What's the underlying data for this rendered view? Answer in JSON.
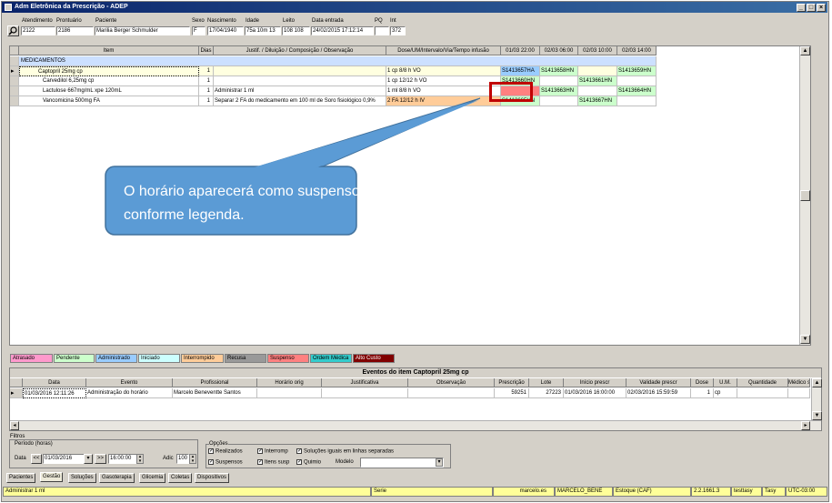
{
  "window": {
    "title": "Adm Eletrônica da Prescrição - ADEP",
    "min": "_",
    "max": "□",
    "close": "×"
  },
  "header": {
    "labels": {
      "atendimento": "Atendimento",
      "prontuario": "Prontuário",
      "paciente": "Paciente",
      "sexo": "Sexo",
      "nascimento": "Nascimento",
      "idade": "Idade",
      "leito": "Leito",
      "data_entrada": "Data entrada",
      "pq": "PQ",
      "int": "Int"
    },
    "values": {
      "atendimento": "2122",
      "prontuario": "2186",
      "paciente": "Marilia Berger Schmulder",
      "sexo": "F",
      "nascimento": "17/04/1940",
      "idade": "75a 10m 13",
      "leito": "108 108",
      "data_entrada": "24/02/2015 17:12:14",
      "pq": "",
      "int": "372"
    }
  },
  "grid": {
    "columns": [
      "Item",
      "Dias",
      "Justif. / Diluição / Composição / Observação",
      "Dose/UM/Intervalo/Via/Tempo infusão",
      "01/03 22:00",
      "02/03 06:00",
      "02/03 10:00",
      "02/03 14:00"
    ],
    "group": "MEDICAMENTOS",
    "rows": [
      {
        "item": "Captopril 25mg cp",
        "dias": "1",
        "justif": "",
        "dose": "1 cp   8/8 h   VO",
        "t1": "S1413657HA",
        "t2": "S1413658HN",
        "t3": "",
        "t4": "S1413659HN"
      },
      {
        "item": "Carvedilol 6,25mg cp",
        "dias": "1",
        "justif": "",
        "dose": "1 cp   12/12 h   VO",
        "t1": "S1413660HN",
        "t2": "",
        "t3": "S1413661HN",
        "t4": ""
      },
      {
        "item": "Lactulose 667mg/mL xpe 120mL",
        "dias": "1",
        "justif": "Administrar 1 ml",
        "dose": "1 ml   8/8 h   VO",
        "t1": "",
        "t2": "S1413663HN",
        "t3": "",
        "t4": "S1413664HN"
      },
      {
        "item": "Vancomicina 500mg FA",
        "dias": "1",
        "justif": "Separar 2 FA do medicamento em 100 ml de Soro fisiológico 0,9%",
        "dose": "2 FA   12/12 h   IV",
        "t1": "S1413665HN",
        "t2": "",
        "t3": "S1413667HN",
        "t4": ""
      }
    ]
  },
  "callout": {
    "text": "O horário aparecerá como suspenso conforme legenda."
  },
  "legend": [
    {
      "label": "Atrasado",
      "color": "#ff99cc"
    },
    {
      "label": "Pendente",
      "color": "#ccffcc"
    },
    {
      "label": "Administrado",
      "color": "#99ccff"
    },
    {
      "label": "Iniciado",
      "color": "#ccffff"
    },
    {
      "label": "Interrompido",
      "color": "#ffcc99"
    },
    {
      "label": "Recusa",
      "color": "#999999"
    },
    {
      "label": "Suspenso",
      "color": "#ff8080"
    },
    {
      "label": "Ordem Médica",
      "color": "#33cccc"
    },
    {
      "label": "Alto Custo",
      "color": "#800000"
    }
  ],
  "events": {
    "title": "Eventos do item Captopril 25mg cp",
    "columns": [
      "Data",
      "Evento",
      "Profissional",
      "Horário orig",
      "Justificativa",
      "Observação",
      "Prescrição",
      "Lote",
      "Início prescr",
      "Validade prescr",
      "Dose",
      "U.M.",
      "Quantidade",
      "Médico se"
    ],
    "row": {
      "data": "01/03/2016 12:11:26",
      "evento": "Administração do horário",
      "profissional": "Marcelo Beneventte Santos",
      "horario": "",
      "justificativa": "",
      "observacao": "",
      "prescricao": "59251",
      "lote": "27223",
      "inicio": "01/03/2016 16:00:00",
      "validade": "02/03/2016 15:59:59",
      "dose": "1",
      "um": "cp",
      "quantidade": "",
      "medico": ""
    }
  },
  "filters": {
    "title": "Filtros",
    "periodo_label": "Período (horas)",
    "data_label": "Data",
    "prev": "<<",
    "date": "01/03/2016",
    "next": ">>",
    "time": "16:00:00",
    "adic_label": "Adic",
    "adic_value": "100",
    "opcoes_title": "Opções",
    "checks": [
      {
        "label": "Realizados",
        "checked": true
      },
      {
        "label": "Interromp",
        "checked": true
      },
      {
        "label": "Soluções iguais em linhas separadas",
        "checked": true
      },
      {
        "label": "Suspensos",
        "checked": true
      },
      {
        "label": "Itens susp",
        "checked": true
      },
      {
        "label": "Quimio",
        "checked": true
      }
    ],
    "modelo_label": "Modelo"
  },
  "tabs": [
    "Pacientes",
    "Gestão",
    "Soluções",
    "Gasoterapia",
    "Glicemia",
    "Coletas",
    "Dispositivos"
  ],
  "status": {
    "left": "Administrar 1 ml",
    "serie": "Serie",
    "user": "marcelo.es",
    "name": "MARCELO_BENE",
    "estoque": "Estoque (CAF)",
    "version": "2.2.1661.3",
    "base": "testtasy",
    "app": "Tasy",
    "tz": "UTC-03:00"
  }
}
